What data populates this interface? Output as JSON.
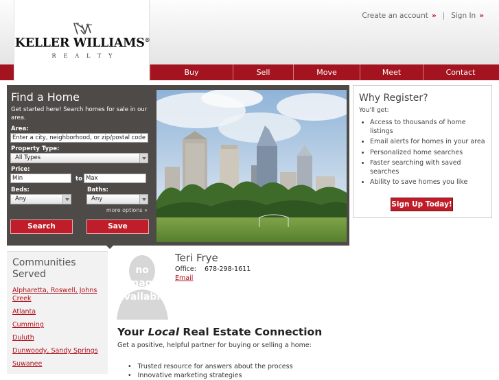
{
  "brand": {
    "name": "KELLER WILLIAMS",
    "registered": "®",
    "sub": "REALTY"
  },
  "top_links": {
    "create": "Create an account",
    "separator": "|",
    "signin": "Sign In",
    "chevron": "»"
  },
  "nav": [
    {
      "label": "Buy"
    },
    {
      "label": "Sell"
    },
    {
      "label": "Move"
    },
    {
      "label": "Meet"
    },
    {
      "label": "Contact"
    }
  ],
  "search": {
    "title": "Find a Home",
    "intro": "Get started here! Search homes for sale in our area.",
    "area_label": "Area:",
    "area_placeholder": "Enter a city, neighborhood, or zip/postal code",
    "type_label": "Property Type:",
    "type_value": "All Types",
    "price_label": "Price:",
    "price_min": "Min",
    "price_to": "to",
    "price_max": "Max",
    "beds_label": "Beds:",
    "beds_value": "Any",
    "baths_label": "Baths:",
    "baths_value": "Any",
    "more": "more options »",
    "search_btn": "Search",
    "save_btn": "Save"
  },
  "why": {
    "title": "Why Register?",
    "youll": "You'll get:",
    "items": [
      "Access to thousands of home listings",
      "Email alerts for homes in your area",
      "Personalized home searches",
      "Faster searching with saved searches",
      "Ability to save homes you like"
    ],
    "signup": "Sign Up Today!"
  },
  "communities": {
    "title": "Communities Served",
    "items": [
      "Alpharetta, Roswell, Johns Creek",
      "Atlanta",
      "Cumming",
      "Duluth",
      "Dunwoody, Sandy Springs",
      "Suwanee"
    ]
  },
  "agent": {
    "no_image_1": "no",
    "no_image_2": "image",
    "no_image_3": "available",
    "name": "Teri Frye",
    "office_label": "Office:",
    "office_phone": "678-298-1611",
    "email": "Email"
  },
  "main": {
    "headline_pre": "Your ",
    "headline_em": "Local",
    "headline_post": " Real Estate Connection",
    "lead": "Get a positive, helpful partner for buying or selling a home:",
    "bullets": [
      "Trusted resource for answers about the process",
      "Innovative marketing strategies"
    ]
  },
  "colors": {
    "brand_red": "#a31420",
    "button_red": "#c01d2a",
    "panel_gray": "#4e4a47"
  }
}
